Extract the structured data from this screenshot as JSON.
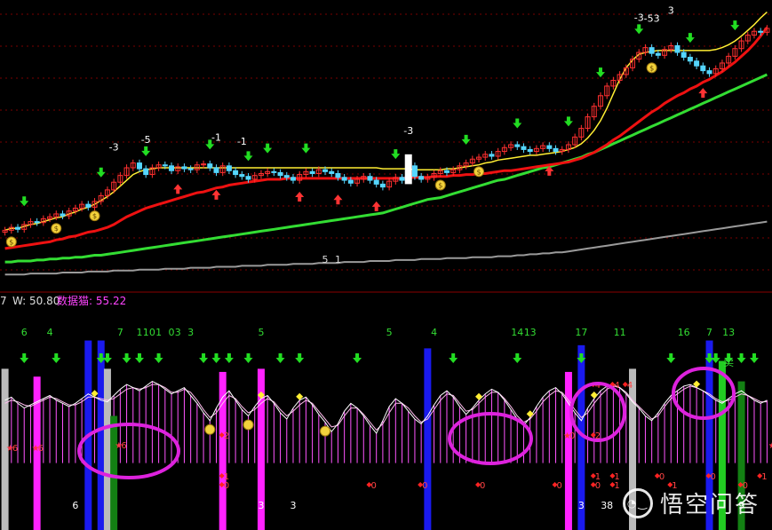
{
  "colors": {
    "background": "#000000",
    "grid": "#7a0000",
    "separator": "#8a0000",
    "candle_up": "#ff3030",
    "candle_down": "#55d6ff",
    "ma_fast": "#ffee33",
    "ma_red": "#ee1111",
    "ma_green": "#33dd33",
    "ma_gray": "#9a9a9a",
    "arrow_buy": "#22dd22",
    "arrow_sell": "#ff3333",
    "osc_hist": "#ff55ff",
    "osc_line": "#ffffff",
    "highlight_ring": "#dd22dd"
  },
  "indicator_header": {
    "prefix": "7",
    "w_label": "W: 50.80",
    "kitten_label": "数据猫: 55.22"
  },
  "watermark_text": "悟空问答",
  "chart_data": [
    {
      "type": "candlestick",
      "panel": "price",
      "grid": true,
      "bars": 120,
      "series": [
        {
          "key": "close",
          "values": [
            20.6,
            20.9,
            20.7,
            21.2,
            21.5,
            21.4,
            21.8,
            22.0,
            22.3,
            22.1,
            22.6,
            22.9,
            23.3,
            23.0,
            23.6,
            24.2,
            24.8,
            25.6,
            26.3,
            27.1,
            27.6,
            27.0,
            26.4,
            27.1,
            27.4,
            27.3,
            26.8,
            27.2,
            27.0,
            26.9,
            27.4,
            27.5,
            27.1,
            26.6,
            27.3,
            26.8,
            26.4,
            26.2,
            25.9,
            26.3,
            26.5,
            26.7,
            26.6,
            26.3,
            26.1,
            25.8,
            26.4,
            26.7,
            26.5,
            26.9,
            26.7,
            26.5,
            26.1,
            25.8,
            25.5,
            25.9,
            26.2,
            25.8,
            25.4,
            25.1,
            25.7,
            26.1,
            25.8,
            27.3,
            26.2,
            25.9,
            26.1,
            26.5,
            26.8,
            26.6,
            26.9,
            27.3,
            27.6,
            28.0,
            28.2,
            28.5,
            28.3,
            28.8,
            29.2,
            29.5,
            29.3,
            29.0,
            28.8,
            29.1,
            29.4,
            29.1,
            28.8,
            29.0,
            29.5,
            30.3,
            31.2,
            32.4,
            33.5,
            34.6,
            35.6,
            36.2,
            36.8,
            37.5,
            38.4,
            39.1,
            39.6,
            39.0,
            38.8,
            39.4,
            39.8,
            39.1,
            38.6,
            38.2,
            37.7,
            37.2,
            36.9,
            37.4,
            38.0,
            38.7,
            39.5,
            40.3,
            40.9,
            41.3,
            41.2,
            41.6
          ]
        },
        {
          "key": "ma_fast",
          "values": [
            20.6,
            20.8,
            20.8,
            21.0,
            21.2,
            21.3,
            21.5,
            21.7,
            21.9,
            22.0,
            22.3,
            22.5,
            22.8,
            23.0,
            23.3,
            23.7,
            24.1,
            24.6,
            25.2,
            25.8,
            26.4,
            26.7,
            26.9,
            27.0,
            27.1,
            27.1,
            27.1,
            27.1,
            27.1,
            27.1,
            27.1,
            27.1,
            27.1,
            27.1,
            27.1,
            27.1,
            27.1,
            27.1,
            27.1,
            27.1,
            27.1,
            27.1,
            27.1,
            27.1,
            27.1,
            27.1,
            27.1,
            27.1,
            27.1,
            27.1,
            27.1,
            27.1,
            27.1,
            27.1,
            27.1,
            27.1,
            27.1,
            27.1,
            27.1,
            27.0,
            27.0,
            27.0,
            27.0,
            27.0,
            26.9,
            26.9,
            26.9,
            26.9,
            26.9,
            27.0,
            27.0,
            27.1,
            27.2,
            27.3,
            27.4,
            27.6,
            27.7,
            27.9,
            28.0,
            28.1,
            28.2,
            28.3,
            28.4,
            28.4,
            28.5,
            28.6,
            28.7,
            28.8,
            29.0,
            29.2,
            29.6,
            30.2,
            31.0,
            32.0,
            33.3,
            34.8,
            36.3,
            37.5,
            38.3,
            38.9,
            39.1,
            39.2,
            39.3,
            39.3,
            39.3,
            39.3,
            39.3,
            39.3,
            39.3,
            39.3,
            39.3,
            39.4,
            39.6,
            39.9,
            40.3,
            40.8,
            41.4,
            42.0,
            42.7,
            43.3
          ]
        },
        {
          "key": "ma_red",
          "values": [
            18.7,
            18.8,
            18.9,
            19.0,
            19.1,
            19.2,
            19.3,
            19.4,
            19.6,
            19.7,
            19.9,
            20.0,
            20.2,
            20.4,
            20.5,
            20.7,
            20.9,
            21.2,
            21.6,
            22.0,
            22.3,
            22.6,
            22.9,
            23.1,
            23.3,
            23.5,
            23.7,
            23.9,
            24.1,
            24.3,
            24.5,
            24.6,
            24.8,
            25.0,
            25.1,
            25.3,
            25.4,
            25.5,
            25.6,
            25.7,
            25.8,
            25.9,
            25.9,
            25.9,
            26.0,
            26.0,
            26.0,
            26.0,
            26.0,
            26.0,
            26.0,
            26.0,
            26.0,
            26.0,
            26.0,
            26.0,
            26.0,
            26.0,
            26.0,
            26.0,
            26.0,
            26.0,
            26.0,
            26.1,
            26.1,
            26.1,
            26.1,
            26.2,
            26.2,
            26.2,
            26.3,
            26.3,
            26.4,
            26.4,
            26.5,
            26.5,
            26.6,
            26.7,
            26.8,
            26.8,
            26.9,
            27.0,
            27.1,
            27.2,
            27.3,
            27.4,
            27.5,
            27.6,
            27.7,
            27.9,
            28.1,
            28.4,
            28.7,
            29.1,
            29.5,
            30.0,
            30.4,
            30.9,
            31.4,
            31.9,
            32.4,
            32.9,
            33.3,
            33.8,
            34.2,
            34.6,
            34.9,
            35.3,
            35.6,
            36.0,
            36.3,
            36.7,
            37.1,
            37.6,
            38.1,
            38.7,
            39.3,
            40.0,
            40.8,
            41.7
          ]
        },
        {
          "key": "ma_green",
          "values": [
            17.3,
            17.3,
            17.4,
            17.4,
            17.4,
            17.5,
            17.5,
            17.6,
            17.6,
            17.7,
            17.7,
            17.8,
            17.8,
            17.9,
            18.0,
            18.0,
            18.1,
            18.2,
            18.3,
            18.4,
            18.5,
            18.6,
            18.7,
            18.8,
            18.9,
            19.0,
            19.1,
            19.2,
            19.3,
            19.4,
            19.5,
            19.6,
            19.7,
            19.8,
            19.9,
            20.0,
            20.1,
            20.2,
            20.3,
            20.4,
            20.5,
            20.6,
            20.7,
            20.8,
            20.9,
            21.0,
            21.1,
            21.2,
            21.3,
            21.4,
            21.5,
            21.6,
            21.7,
            21.8,
            21.9,
            22.0,
            22.1,
            22.2,
            22.3,
            22.4,
            22.6,
            22.8,
            23.0,
            23.2,
            23.4,
            23.6,
            23.8,
            23.9,
            24.0,
            24.2,
            24.4,
            24.6,
            24.8,
            25.0,
            25.2,
            25.4,
            25.6,
            25.8,
            25.9,
            26.1,
            26.3,
            26.5,
            26.7,
            26.9,
            27.1,
            27.2,
            27.4,
            27.6,
            27.8,
            28.0,
            28.2,
            28.5,
            28.7,
            29.0,
            29.3,
            29.6,
            29.9,
            30.2,
            30.5,
            30.8,
            31.1,
            31.4,
            31.7,
            32.0,
            32.3,
            32.6,
            32.9,
            33.2,
            33.5,
            33.8,
            34.1,
            34.4,
            34.7,
            35.0,
            35.3,
            35.6,
            35.9,
            36.2,
            36.5,
            36.8
          ]
        },
        {
          "key": "ma_gray",
          "values": [
            16.0,
            16.0,
            16.0,
            16.0,
            16.1,
            16.1,
            16.1,
            16.1,
            16.1,
            16.2,
            16.2,
            16.2,
            16.2,
            16.3,
            16.3,
            16.3,
            16.3,
            16.4,
            16.4,
            16.4,
            16.4,
            16.5,
            16.5,
            16.5,
            16.5,
            16.6,
            16.6,
            16.6,
            16.6,
            16.7,
            16.7,
            16.7,
            16.7,
            16.8,
            16.8,
            16.8,
            16.8,
            16.9,
            16.9,
            16.9,
            16.9,
            17.0,
            17.0,
            17.0,
            17.0,
            17.1,
            17.1,
            17.1,
            17.1,
            17.2,
            17.2,
            17.2,
            17.2,
            17.3,
            17.3,
            17.3,
            17.3,
            17.4,
            17.4,
            17.4,
            17.4,
            17.5,
            17.5,
            17.5,
            17.5,
            17.6,
            17.6,
            17.6,
            17.6,
            17.7,
            17.7,
            17.7,
            17.7,
            17.8,
            17.8,
            17.8,
            17.8,
            17.9,
            17.9,
            17.9,
            18.0,
            18.0,
            18.1,
            18.1,
            18.2,
            18.2,
            18.3,
            18.3,
            18.4,
            18.5,
            18.6,
            18.7,
            18.8,
            18.9,
            19.0,
            19.1,
            19.2,
            19.3,
            19.4,
            19.5,
            19.6,
            19.7,
            19.8,
            19.9,
            20.0,
            20.1,
            20.2,
            20.3,
            20.4,
            20.5,
            20.6,
            20.7,
            20.8,
            20.9,
            21.0,
            21.1,
            21.2,
            21.3,
            21.4,
            21.5
          ]
        }
      ],
      "highlight_bar": {
        "index": 63,
        "value": 27.3
      },
      "buy_signals": [
        3,
        15,
        22,
        32,
        38,
        41,
        47,
        61,
        72,
        80,
        88,
        93,
        99,
        107,
        114
      ],
      "sell_signals": [
        27,
        33,
        46,
        52,
        58,
        85,
        109
      ],
      "coin_markers": [
        1,
        8,
        14,
        68,
        74,
        101
      ],
      "annotations": [
        "-3",
        "-5",
        "-1",
        "-1",
        "-3",
        "-3",
        "-53",
        "3",
        "5",
        "1"
      ],
      "ylim": [
        15,
        44
      ]
    },
    {
      "type": "oscillator",
      "panel": "indicator",
      "ylim": [
        0,
        100
      ],
      "values": [
        60,
        62,
        58,
        55,
        57,
        59,
        61,
        63,
        60,
        58,
        56,
        58,
        61,
        64,
        62,
        60,
        59,
        63,
        67,
        70,
        68,
        66,
        69,
        72,
        70,
        67,
        64,
        66,
        68,
        63,
        58,
        52,
        47,
        55,
        62,
        66,
        60,
        54,
        50,
        56,
        61,
        63,
        58,
        52,
        48,
        55,
        60,
        62,
        57,
        51,
        46,
        40,
        45,
        53,
        58,
        55,
        50,
        44,
        39,
        47,
        56,
        61,
        58,
        53,
        48,
        45,
        50,
        57,
        63,
        66,
        62,
        56,
        51,
        55,
        60,
        64,
        67,
        65,
        60,
        54,
        48,
        44,
        49,
        56,
        62,
        66,
        68,
        64,
        58,
        52,
        47,
        55,
        61,
        66,
        69,
        70,
        68,
        64,
        59,
        55,
        50,
        47,
        52,
        58,
        63,
        66,
        69,
        70,
        68,
        66,
        63,
        60,
        58,
        61,
        64,
        66,
        63,
        60,
        58,
        60
      ],
      "signal": [
        58,
        60,
        59,
        57,
        56,
        58,
        60,
        62,
        61,
        59,
        57,
        57,
        59,
        62,
        62,
        61,
        60,
        61,
        64,
        67,
        68,
        67,
        68,
        70,
        70,
        68,
        65,
        65,
        67,
        65,
        60,
        54,
        49,
        52,
        58,
        63,
        61,
        56,
        52,
        54,
        58,
        61,
        59,
        54,
        50,
        53,
        57,
        60,
        58,
        53,
        48,
        43,
        44,
        50,
        55,
        55,
        51,
        46,
        41,
        45,
        52,
        58,
        58,
        55,
        50,
        46,
        48,
        54,
        60,
        64,
        63,
        58,
        53,
        54,
        58,
        62,
        65,
        65,
        61,
        56,
        50,
        46,
        48,
        53,
        59,
        63,
        66,
        65,
        60,
        54,
        49,
        52,
        58,
        63,
        67,
        69,
        68,
        65,
        60,
        56,
        52,
        48,
        50,
        56,
        61,
        64,
        67,
        69,
        68,
        66,
        64,
        61,
        59,
        60,
        62,
        64,
        63,
        61,
        59,
        59
      ],
      "top_labels": [
        "6",
        "4",
        "7",
        "1",
        "1",
        "0",
        "1",
        "0",
        "3",
        "3",
        "5",
        "5",
        "4",
        "14",
        "13",
        "17",
        "11",
        "16",
        "7",
        "13"
      ],
      "bottom_labels": [
        "6",
        "3",
        "3",
        "3",
        "38",
        "9"
      ],
      "diamond_tags": [
        "6",
        "6",
        "6",
        "2",
        "4",
        "4",
        "4",
        "2",
        "1",
        "1",
        "0",
        "0",
        "0",
        "0",
        "0",
        "0",
        "1",
        "1",
        "0",
        "0",
        "1",
        "0",
        "0",
        "1",
        "6"
      ],
      "sell_text": "卖",
      "tall_bars": [
        {
          "index": 13,
          "value": 98,
          "color": "#1a1aee"
        },
        {
          "index": 15,
          "value": 98,
          "color": "#1a1aee"
        },
        {
          "index": 66,
          "value": 93,
          "color": "#1a1aee"
        },
        {
          "index": 90,
          "value": 95,
          "color": "#1a1aee"
        },
        {
          "index": 110,
          "value": 98,
          "color": "#1a1aee"
        },
        {
          "index": 112,
          "value": 85,
          "color": "#22cc22"
        },
        {
          "index": 115,
          "value": 72,
          "color": "#138013"
        },
        {
          "index": 16,
          "value": 80,
          "color": "#bbbbbb"
        },
        {
          "index": 0,
          "value": 80,
          "color": "#bbbbbb"
        },
        {
          "index": 98,
          "value": 80,
          "color": "#bbbbbb"
        },
        {
          "index": 5,
          "value": 75,
          "color": "#ff22ff"
        },
        {
          "index": 34,
          "value": 78,
          "color": "#ff22ff"
        },
        {
          "index": 40,
          "value": 80,
          "color": "#ff22ff"
        },
        {
          "index": 88,
          "value": 78,
          "color": "#ff22ff"
        },
        {
          "index": 17,
          "value": 50,
          "color": "#138013"
        }
      ]
    }
  ]
}
